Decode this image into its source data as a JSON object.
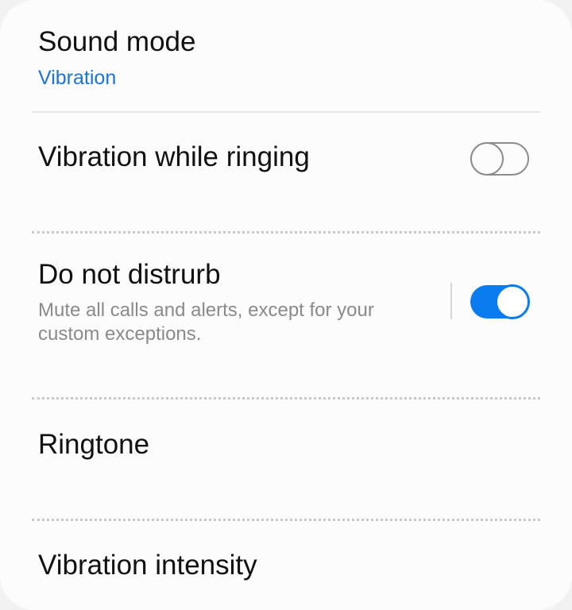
{
  "sound_mode": {
    "title": "Sound mode",
    "value": "Vibration"
  },
  "vibration_while_ringing": {
    "title": "Vibration while ringing",
    "enabled": false
  },
  "do_not_disturb": {
    "title": "Do not distrurb",
    "description": "Mute all calls and alerts, except for your custom exceptions.",
    "enabled": true
  },
  "ringtone": {
    "title": "Ringtone"
  },
  "vibration_intensity": {
    "title": "Vibration intensity"
  },
  "colors": {
    "accent": "#0a7cf0",
    "link": "#1a73d8",
    "background": "#fcfcfc"
  }
}
